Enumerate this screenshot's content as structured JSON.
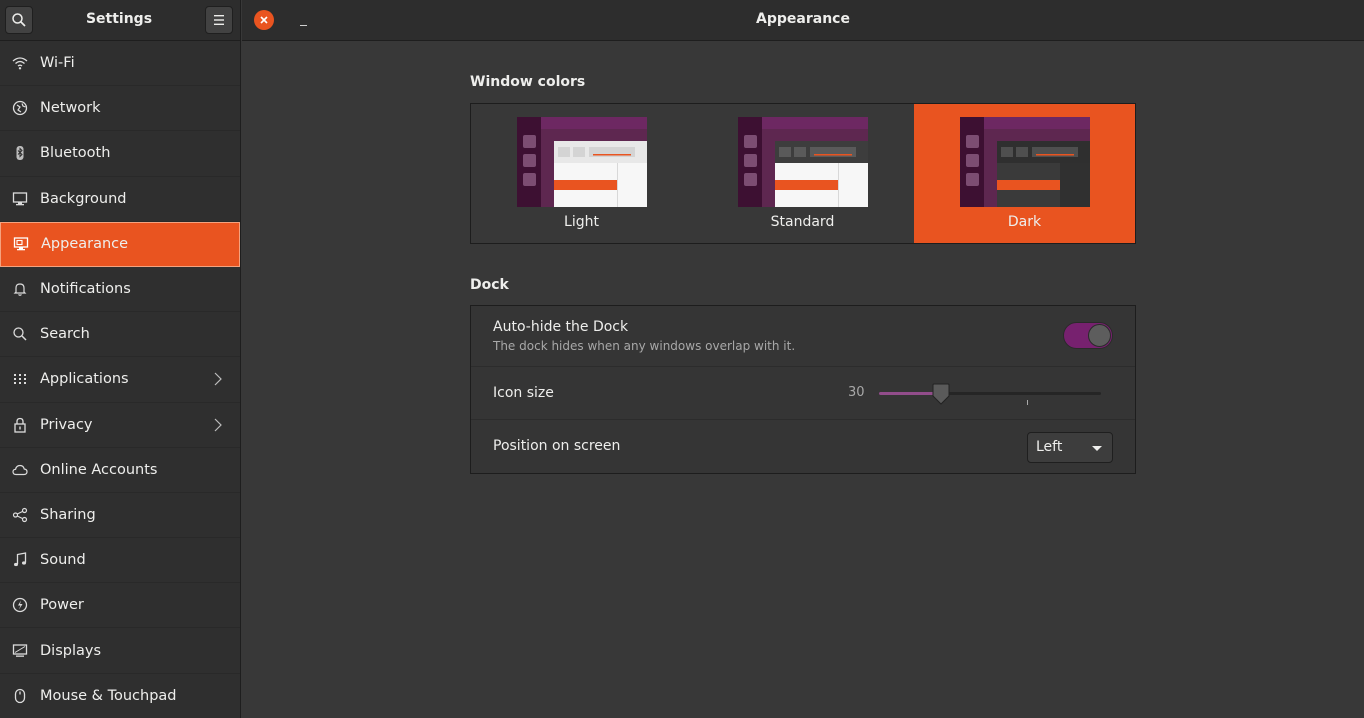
{
  "sidebar": {
    "title": "Settings",
    "items": [
      {
        "label": "Wi-Fi",
        "icon": "wifi-icon"
      },
      {
        "label": "Network",
        "icon": "network-icon"
      },
      {
        "label": "Bluetooth",
        "icon": "bluetooth-icon"
      },
      {
        "label": "Background",
        "icon": "background-icon"
      },
      {
        "label": "Appearance",
        "icon": "appearance-icon",
        "active": true
      },
      {
        "label": "Notifications",
        "icon": "bell-icon"
      },
      {
        "label": "Search",
        "icon": "search-icon"
      },
      {
        "label": "Applications",
        "icon": "grid-icon",
        "submenu": true
      },
      {
        "label": "Privacy",
        "icon": "lock-icon",
        "submenu": true
      },
      {
        "label": "Online Accounts",
        "icon": "cloud-icon"
      },
      {
        "label": "Sharing",
        "icon": "share-icon"
      },
      {
        "label": "Sound",
        "icon": "music-note-icon"
      },
      {
        "label": "Power",
        "icon": "power-icon"
      },
      {
        "label": "Displays",
        "icon": "display-icon"
      },
      {
        "label": "Mouse & Touchpad",
        "icon": "mouse-icon"
      }
    ]
  },
  "main": {
    "title": "Appearance",
    "window_colors": {
      "heading": "Window colors",
      "options": [
        {
          "label": "Light"
        },
        {
          "label": "Standard"
        },
        {
          "label": "Dark",
          "selected": true
        }
      ]
    },
    "dock": {
      "heading": "Dock",
      "autohide": {
        "title": "Auto-hide the Dock",
        "subtitle": "The dock hides when any windows overlap with it.",
        "enabled": true
      },
      "icon_size": {
        "title": "Icon size",
        "value": "30",
        "min": 16,
        "max": 64,
        "current": 30
      },
      "position": {
        "title": "Position on screen",
        "selected": "Left"
      }
    }
  },
  "colors": {
    "accent": "#e95420",
    "toggle_on": "#77216f",
    "slider_fill": "#924d8b"
  }
}
